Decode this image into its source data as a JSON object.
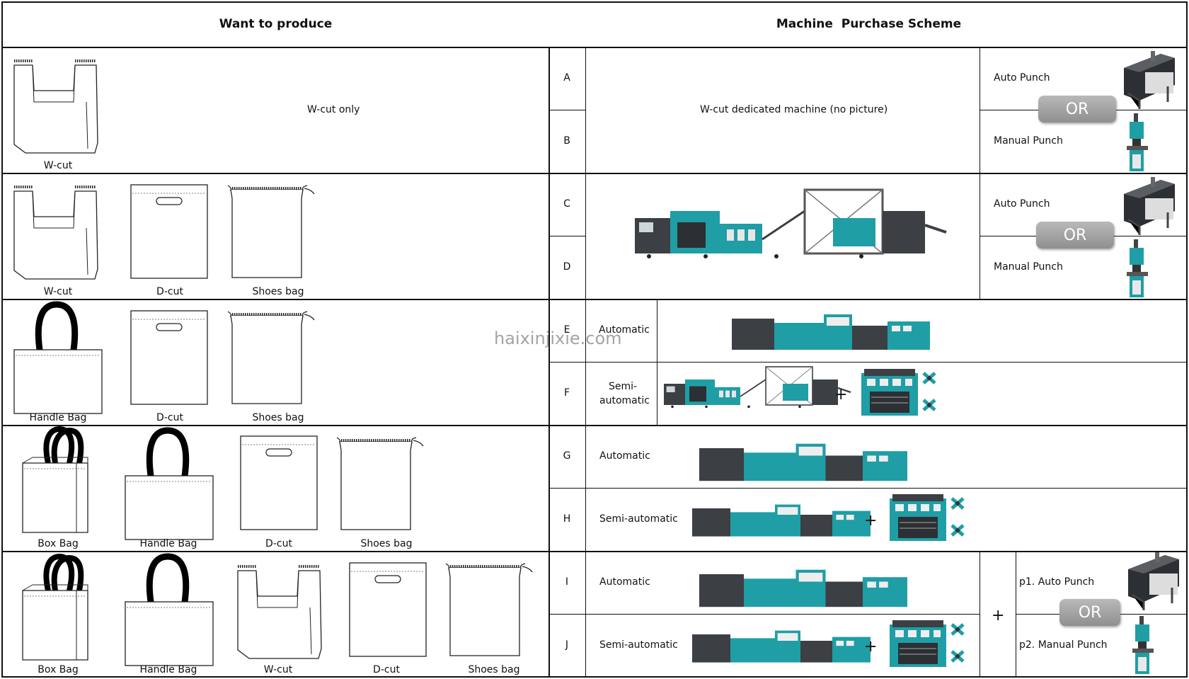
{
  "headers": {
    "want": "Want to produce",
    "scheme": "Machine  Purchase Scheme"
  },
  "rows": [
    {
      "bags": [
        "W-cut"
      ],
      "desc": "W-cut only"
    },
    {
      "bags": [
        "W-cut",
        "D-cut",
        "Shoes bag"
      ]
    },
    {
      "bags": [
        "Handle Bag",
        "D-cut",
        "Shoes bag"
      ]
    },
    {
      "bags": [
        "Box Bag",
        "Handle Bag",
        "D-cut",
        "Shoes bag"
      ]
    },
    {
      "bags": [
        "Box Bag",
        "Handle Bag",
        "W-cut",
        "D-cut",
        "Shoes bag"
      ]
    }
  ],
  "options": [
    {
      "letter": "A",
      "punch": "Auto Punch"
    },
    {
      "letter": "B",
      "punch": "Manual Punch"
    },
    {
      "letter": "C",
      "punch": "Auto Punch"
    },
    {
      "letter": "D",
      "punch": "Manual Punch"
    },
    {
      "letter": "E",
      "mode": "Automatic"
    },
    {
      "letter": "F",
      "mode": "Semi-automatic",
      "mode_l1": "Semi-",
      "mode_l2": "automatic"
    },
    {
      "letter": "G",
      "mode": "Automatic"
    },
    {
      "letter": "H",
      "mode": "Semi-automatic"
    },
    {
      "letter": "I",
      "mode": "Automatic",
      "punch": "p1. Auto Punch"
    },
    {
      "letter": "J",
      "mode": "Semi-automatic",
      "punch": "p2. Manual Punch"
    }
  ],
  "ab_machine": "W-cut dedicated machine (no picture)",
  "or_label": "OR",
  "plus_sign": "+",
  "watermark": "haixinjixie.com",
  "colors": {
    "machine_teal": "#1f9ea6",
    "machine_dark": "#3c3f44",
    "or_button": "#a4a4a4"
  }
}
